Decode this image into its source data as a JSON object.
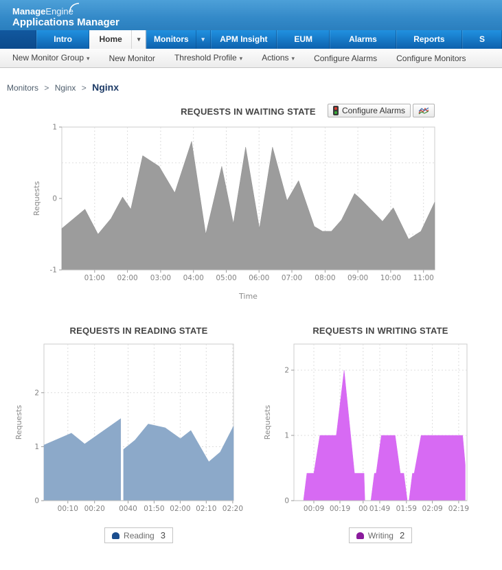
{
  "header": {
    "logo_bold": "Manage",
    "logo_light": "Engine",
    "logo_sub": "Applications Manager"
  },
  "icons": {
    "chevron_down": "▾",
    "breadcrumb_separator": ">"
  },
  "tabs": [
    {
      "label": "Intro"
    },
    {
      "label": "Home",
      "active": true
    },
    {
      "label": "Monitors"
    },
    {
      "label": "APM Insight"
    },
    {
      "label": "EUM"
    },
    {
      "label": "Alarms"
    },
    {
      "label": "Reports"
    },
    {
      "label": "S"
    }
  ],
  "toolbar": {
    "items": [
      {
        "label": "New Monitor Group"
      },
      {
        "label": "New Monitor"
      },
      {
        "label": "Threshold Profile"
      },
      {
        "label": "Actions"
      },
      {
        "label": "Configure Alarms"
      },
      {
        "label": "Configure Monitors"
      }
    ]
  },
  "breadcrumb": {
    "links": [
      "Monitors",
      "Nginx"
    ],
    "separator": ">",
    "current": "Nginx"
  },
  "chart_controls": {
    "configure_alarms_label": "Configure Alarms"
  },
  "legends": [
    {
      "label": "Reading",
      "value": "3",
      "color": "#1b4e8e"
    },
    {
      "label": "Writing",
      "value": "2",
      "color": "#8a1a9c"
    }
  ],
  "chart_data": [
    {
      "type": "area",
      "title": "REQUESTS IN WAITING STATE",
      "xlabel": "Time",
      "ylabel": "Requests",
      "ylim": [
        -1,
        1
      ],
      "baseline": -1,
      "fill": "#9c9c9c",
      "stroke": "#8f8f8f",
      "grid": true,
      "yticks": [
        {
          "v": 1,
          "label": "1"
        },
        {
          "v": 0,
          "label": "0"
        },
        {
          "v": -1,
          "label": "-1"
        }
      ],
      "ygrid": [
        0.5,
        -0.5
      ],
      "xticks": [
        {
          "pos": 0.088,
          "label": "01:00"
        },
        {
          "pos": 0.176,
          "label": "02:00"
        },
        {
          "pos": 0.265,
          "label": "03:00"
        },
        {
          "pos": 0.353,
          "label": "04:00"
        },
        {
          "pos": 0.441,
          "label": "05:00"
        },
        {
          "pos": 0.529,
          "label": "06:00"
        },
        {
          "pos": 0.617,
          "label": "07:00"
        },
        {
          "pos": 0.706,
          "label": "08:00"
        },
        {
          "pos": 0.794,
          "label": "09:00"
        },
        {
          "pos": 0.882,
          "label": "10:00"
        },
        {
          "pos": 0.97,
          "label": "11:00"
        }
      ],
      "segments": [
        [
          [
            0,
            -0.42
          ],
          [
            0.062,
            -0.15
          ],
          [
            0.097,
            -0.5
          ],
          [
            0.132,
            -0.28
          ],
          [
            0.163,
            0.02
          ],
          [
            0.185,
            -0.15
          ],
          [
            0.217,
            0.6
          ],
          [
            0.261,
            0.45
          ],
          [
            0.303,
            0.08
          ],
          [
            0.348,
            0.8
          ],
          [
            0.386,
            -0.5
          ],
          [
            0.429,
            0.45
          ],
          [
            0.46,
            -0.35
          ],
          [
            0.493,
            0.72
          ],
          [
            0.53,
            -0.42
          ],
          [
            0.565,
            0.72
          ],
          [
            0.604,
            -0.03
          ],
          [
            0.635,
            0.25
          ],
          [
            0.677,
            -0.39
          ],
          [
            0.699,
            -0.46
          ],
          [
            0.723,
            -0.46
          ],
          [
            0.75,
            -0.3
          ],
          [
            0.785,
            0.07
          ],
          [
            0.802,
            -0.01
          ],
          [
            0.86,
            -0.32
          ],
          [
            0.889,
            -0.13
          ],
          [
            0.93,
            -0.57
          ],
          [
            0.963,
            -0.46
          ],
          [
            1.0,
            -0.05
          ]
        ]
      ]
    },
    {
      "type": "area",
      "title": "REQUESTS IN READING STATE",
      "xlabel": "",
      "ylabel": "Requests",
      "ylim": [
        0,
        2.9
      ],
      "baseline": 0,
      "fill": "#8ca9c9",
      "stroke": "#8ca9c9",
      "grid": true,
      "yticks": [
        {
          "v": 0,
          "label": "0"
        },
        {
          "v": 1,
          "label": "1"
        },
        {
          "v": 2,
          "label": "2"
        }
      ],
      "ygrid": [
        1,
        2
      ],
      "xticks": [
        {
          "pos": 0.126,
          "label": "00:10"
        },
        {
          "pos": 0.267,
          "label": "00:20"
        },
        {
          "pos": 0.444,
          "label": "0040"
        },
        {
          "pos": 0.581,
          "label": "01:50"
        },
        {
          "pos": 0.719,
          "label": "02:00"
        },
        {
          "pos": 0.856,
          "label": "02:10"
        },
        {
          "pos": 0.996,
          "label": "02:20"
        }
      ],
      "segments": [
        [
          [
            0,
            1.03
          ],
          [
            0.145,
            1.25
          ],
          [
            0.215,
            1.05
          ],
          [
            0.405,
            1.52
          ]
        ],
        [
          [
            0.42,
            0.95
          ],
          [
            0.48,
            1.12
          ],
          [
            0.55,
            1.42
          ],
          [
            0.64,
            1.35
          ],
          [
            0.72,
            1.15
          ],
          [
            0.775,
            1.3
          ],
          [
            0.87,
            0.72
          ],
          [
            0.93,
            0.9
          ],
          [
            1.0,
            1.38
          ]
        ]
      ]
    },
    {
      "type": "area",
      "title": "REQUESTS IN WRITING STATE",
      "xlabel": "",
      "ylabel": "Requests",
      "ylim": [
        0,
        2.4
      ],
      "baseline": 0,
      "fill": "#d76af3",
      "stroke": "#d76af3",
      "grid": true,
      "yticks": [
        {
          "v": 0,
          "label": "0"
        },
        {
          "v": 1,
          "label": "1"
        },
        {
          "v": 2,
          "label": "2"
        }
      ],
      "ygrid": [
        1,
        2
      ],
      "xticks": [
        {
          "pos": 0.115,
          "label": "00:09"
        },
        {
          "pos": 0.266,
          "label": "00:19"
        },
        {
          "pos": 0.4,
          "label": "00"
        },
        {
          "pos": 0.496,
          "label": "01:49"
        },
        {
          "pos": 0.65,
          "label": "01:59"
        },
        {
          "pos": 0.8,
          "label": "02:09"
        },
        {
          "pos": 0.952,
          "label": "02:19"
        }
      ],
      "segments": [
        [
          [
            0.055,
            0
          ],
          [
            0.075,
            0.42
          ],
          [
            0.115,
            0.42
          ],
          [
            0.15,
            1
          ],
          [
            0.245,
            1
          ],
          [
            0.29,
            2
          ],
          [
            0.35,
            0.42
          ],
          [
            0.405,
            0.42
          ],
          [
            0.41,
            0
          ]
        ],
        [
          [
            0.445,
            0
          ],
          [
            0.465,
            0.42
          ],
          [
            0.475,
            0.42
          ],
          [
            0.505,
            1
          ],
          [
            0.585,
            1
          ],
          [
            0.615,
            0.42
          ],
          [
            0.635,
            0.42
          ],
          [
            0.655,
            0
          ]
        ],
        [
          [
            0.665,
            0
          ],
          [
            0.685,
            0.42
          ],
          [
            0.695,
            0.42
          ],
          [
            0.735,
            1
          ],
          [
            0.975,
            1
          ],
          [
            0.99,
            0.55
          ]
        ]
      ]
    }
  ]
}
